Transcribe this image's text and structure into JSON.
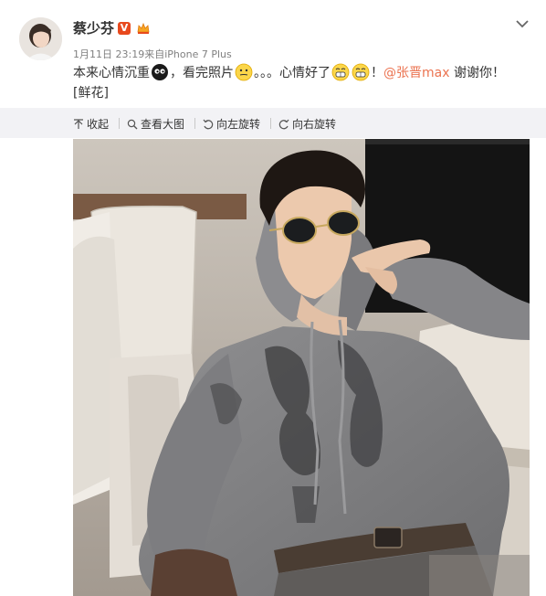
{
  "user": {
    "name": "蔡少芬",
    "verified_badge": "V",
    "timestamp": "1月11日 23:19",
    "source": "来自iPhone 7 Plus"
  },
  "post": {
    "text_1": "本来心情沉重",
    "text_2": "，看完照片",
    "text_3": "。。。心情好了",
    "text_4": "！",
    "mention": "@张晋max",
    "text_5": " 谢谢你！",
    "tag": "[鲜花]"
  },
  "toolbar": {
    "collapse": "收起",
    "view_large": "查看大图",
    "rotate_left": "向左旋转",
    "rotate_right": "向右旋转"
  },
  "colors": {
    "accent": "#eb7350",
    "badge": "#e8491d",
    "toolbar_bg": "#f2f2f5"
  },
  "icons": [
    "dropdown-chevron-icon",
    "verified-v-icon",
    "vip-crown-icon",
    "upload-arrow-icon",
    "magnifier-icon",
    "rotate-left-icon",
    "rotate-right-icon"
  ]
}
